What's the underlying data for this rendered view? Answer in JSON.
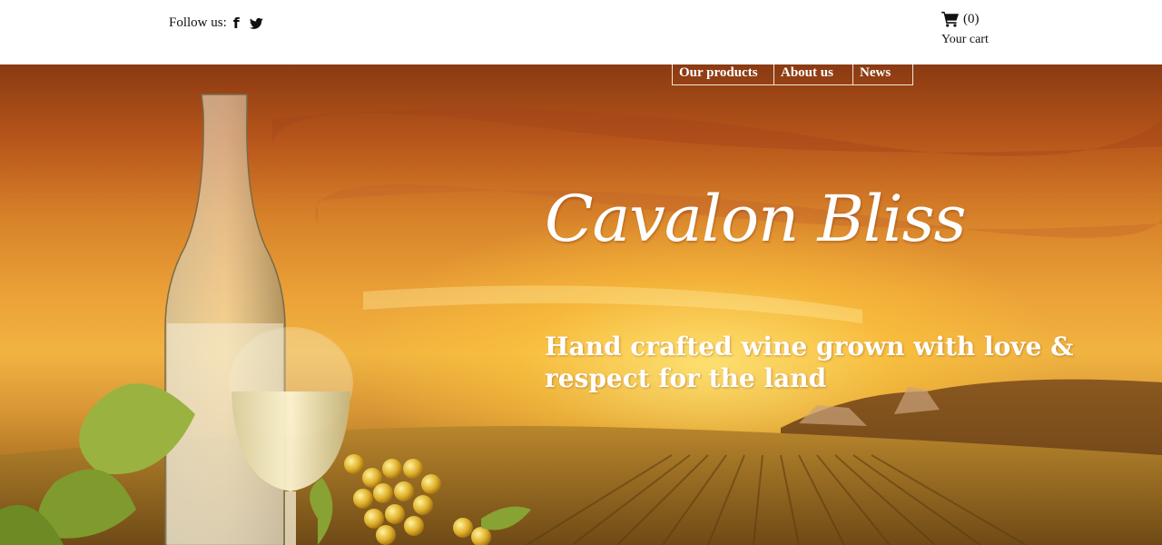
{
  "header": {
    "follow_label": "Follow us:",
    "social": [
      {
        "icon": "facebook-icon",
        "glyph": "f"
      },
      {
        "icon": "twitter-icon"
      }
    ],
    "cart": {
      "icon": "cart-icon",
      "count": "(0)",
      "label": "Your cart"
    }
  },
  "nav": {
    "items": [
      {
        "label": "Our products"
      },
      {
        "label": "About us"
      },
      {
        "label": "News"
      }
    ]
  },
  "hero": {
    "brand": "Cavalon Bliss",
    "tagline": "Hand crafted wine grown with love & respect for the land"
  },
  "colors": {
    "sky_top": "#8a3a12",
    "sky_glow": "#f1b441",
    "text": "#ffffff"
  }
}
